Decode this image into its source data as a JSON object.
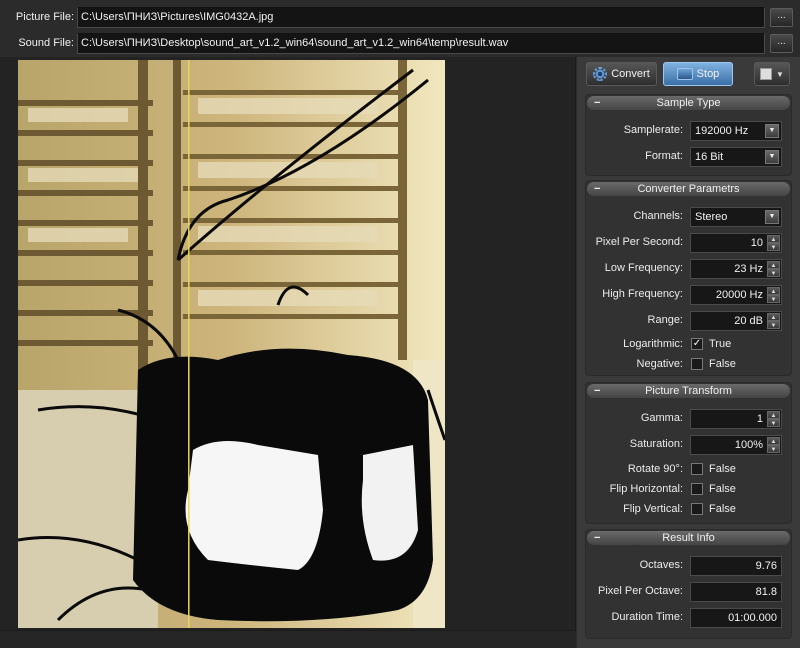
{
  "files": {
    "picture_label": "Picture File:",
    "picture_path": "C:\\Users\\ПНИЗ\\Pictures\\IMG0432A.jpg",
    "sound_label": "Sound File:",
    "sound_path": "C:\\Users\\ПНИЗ\\Desktop\\sound_art_v1.2_win64\\sound_art_v1.2_win64\\temp\\result.wav",
    "browse_label": "..."
  },
  "toolbar": {
    "convert_label": "Convert",
    "stop_label": "Stop",
    "view_icon": "layout-icon"
  },
  "sample_type": {
    "header": "Sample Type",
    "samplerate_label": "Samplerate:",
    "samplerate_value": "192000 Hz",
    "format_label": "Format:",
    "format_value": "16 Bit"
  },
  "converter": {
    "header": "Converter Parametrs",
    "channels_label": "Channels:",
    "channels_value": "Stereo",
    "pps_label": "Pixel Per Second:",
    "pps_value": "10",
    "low_label": "Low Frequency:",
    "low_value": "23 Hz",
    "high_label": "High Frequency:",
    "high_value": "20000 Hz",
    "range_label": "Range:",
    "range_value": "20 dB",
    "log_label": "Logarithmic:",
    "log_value": "True",
    "log_checked": true,
    "neg_label": "Negative:",
    "neg_value": "False",
    "neg_checked": false
  },
  "transform": {
    "header": "Picture Transform",
    "gamma_label": "Gamma:",
    "gamma_value": "1",
    "saturation_label": "Saturation:",
    "saturation_value": "100%",
    "rotate_label": "Rotate 90°:",
    "rotate_value": "False",
    "fliph_label": "Flip Horizontal:",
    "fliph_value": "False",
    "flipv_label": "Flip Vertical:",
    "flipv_value": "False"
  },
  "result": {
    "header": "Result Info",
    "octaves_label": "Octaves:",
    "octaves_value": "9.76",
    "ppo_label": "Pixel Per Octave:",
    "ppo_value": "81.8",
    "duration_label": "Duration Time:",
    "duration_value": "01:00.000"
  },
  "group_collapse_glyph": "−",
  "spin_up": "▲",
  "spin_down": "▼",
  "combo_arrow": "▼",
  "check_mark": "✓",
  "playhead_position": 0.4
}
